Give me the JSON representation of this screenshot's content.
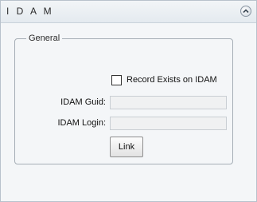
{
  "panel": {
    "title": "I D A M",
    "collapse_icon": "chevron-up-icon"
  },
  "general": {
    "legend": "General",
    "record_exists": {
      "label": "Record Exists on IDAM",
      "checked": false
    },
    "guid": {
      "label": "IDAM Guid:",
      "value": ""
    },
    "login": {
      "label": "IDAM Login:",
      "value": ""
    },
    "link_button": "Link"
  }
}
